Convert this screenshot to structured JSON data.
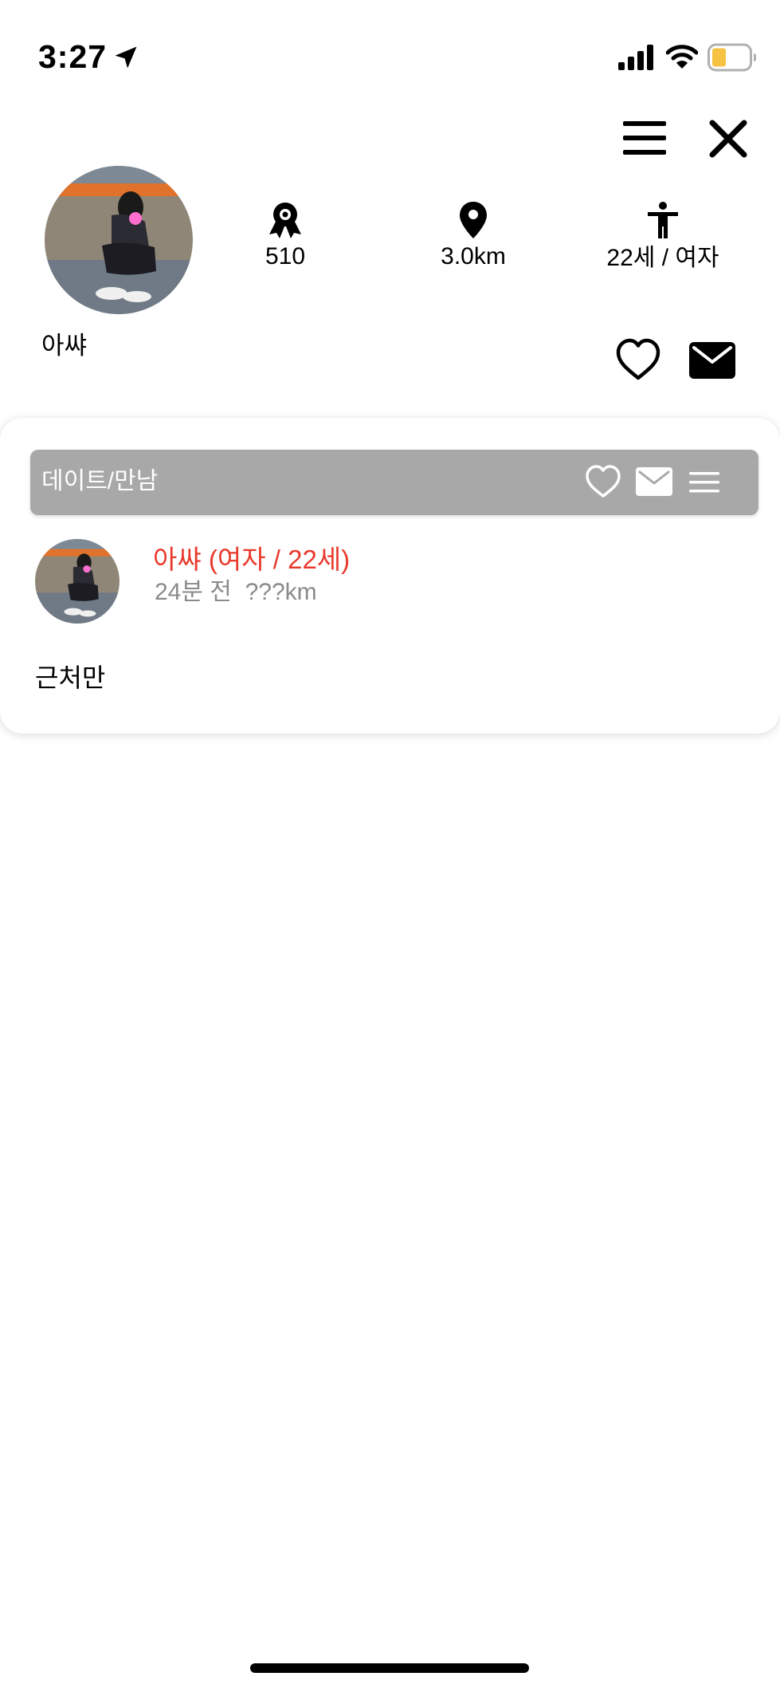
{
  "status_bar": {
    "time": "3:27"
  },
  "header": {
    "menu_icon": "hamburger-menu-icon",
    "close_icon": "close-icon"
  },
  "profile": {
    "name": "아쌰",
    "stats": {
      "badge_value": "510",
      "distance": "3.0km",
      "age_gender": "22세 / 여자"
    },
    "actions": {
      "like_icon": "heart-outline-icon",
      "message_icon": "envelope-icon"
    }
  },
  "post": {
    "category": "데이트/만남",
    "author": "아쌰 (여자 / 22세)",
    "time_ago": "24분 전",
    "distance": "???km",
    "body": "근처만"
  },
  "colors": {
    "author_name": "#e8392b",
    "category_bar": "#a8a8a8",
    "meta_text": "#8a8a8a",
    "battery_fill": "#f5c242"
  }
}
